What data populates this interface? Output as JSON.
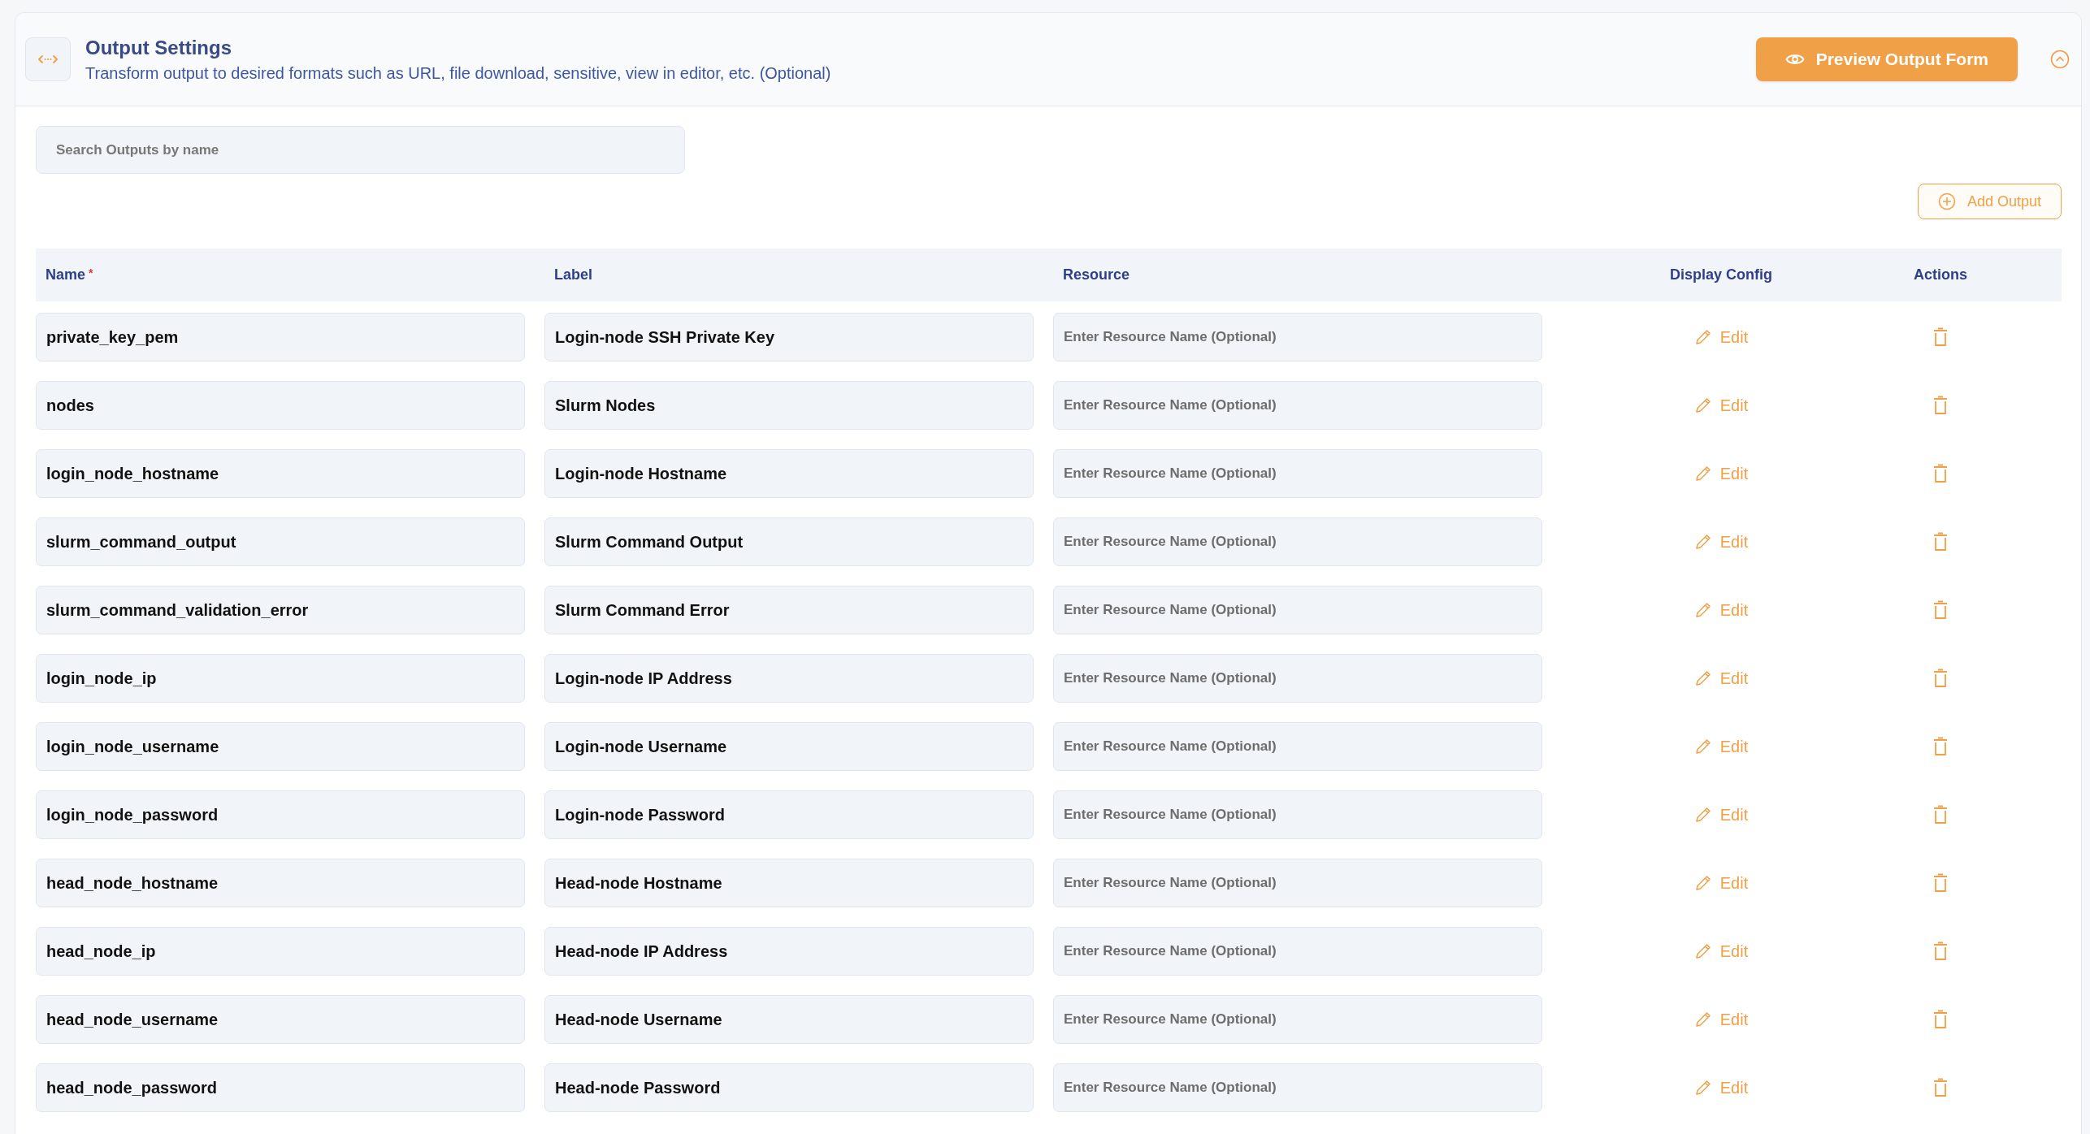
{
  "panel": {
    "title": "Output Settings",
    "subtitle": "Transform output to desired formats such as URL, file download, sensitive, view in editor, etc. (Optional)",
    "preview_button": "Preview Output Form",
    "collapsed": false
  },
  "search": {
    "placeholder": "Search Outputs by name"
  },
  "add_button": "Add Output",
  "table": {
    "columns": [
      {
        "label": "Name",
        "required_mark": "*"
      },
      {
        "label": "Label"
      },
      {
        "label": "Resource"
      },
      {
        "label": "Display Config"
      },
      {
        "label": "Actions"
      }
    ],
    "rows": [
      {
        "name": "private_key_pem",
        "label": "Login-node SSH Private Key",
        "resource_placeholder": "Enter Resource Name (Optional)",
        "edit": "Edit"
      },
      {
        "name": "nodes",
        "label": "Slurm Nodes",
        "resource_placeholder": "Enter Resource Name (Optional)",
        "edit": "Edit"
      },
      {
        "name": "login_node_hostname",
        "label": "Login-node Hostname",
        "resource_placeholder": "Enter Resource Name (Optional)",
        "edit": "Edit"
      },
      {
        "name": "slurm_command_output",
        "label": "Slurm Command Output",
        "resource_placeholder": "Enter Resource Name (Optional)",
        "edit": "Edit"
      },
      {
        "name": "slurm_command_validation_error",
        "label": "Slurm Command Error",
        "resource_placeholder": "Enter Resource Name (Optional)",
        "edit": "Edit"
      },
      {
        "name": "login_node_ip",
        "label": "Login-node IP Address",
        "resource_placeholder": "Enter Resource Name (Optional)",
        "edit": "Edit"
      },
      {
        "name": "login_node_username",
        "label": "Login-node Username",
        "resource_placeholder": "Enter Resource Name (Optional)",
        "edit": "Edit"
      },
      {
        "name": "login_node_password",
        "label": "Login-node Password",
        "resource_placeholder": "Enter Resource Name (Optional)",
        "edit": "Edit"
      },
      {
        "name": "head_node_hostname",
        "label": "Head-node Hostname",
        "resource_placeholder": "Enter Resource Name (Optional)",
        "edit": "Edit"
      },
      {
        "name": "head_node_ip",
        "label": "Head-node IP Address",
        "resource_placeholder": "Enter Resource Name (Optional)",
        "edit": "Edit"
      },
      {
        "name": "head_node_username",
        "label": "Head-node Username",
        "resource_placeholder": "Enter Resource Name (Optional)",
        "edit": "Edit"
      },
      {
        "name": "head_node_password",
        "label": "Head-node Password",
        "resource_placeholder": "Enter Resource Name (Optional)",
        "edit": "Edit"
      }
    ]
  }
}
